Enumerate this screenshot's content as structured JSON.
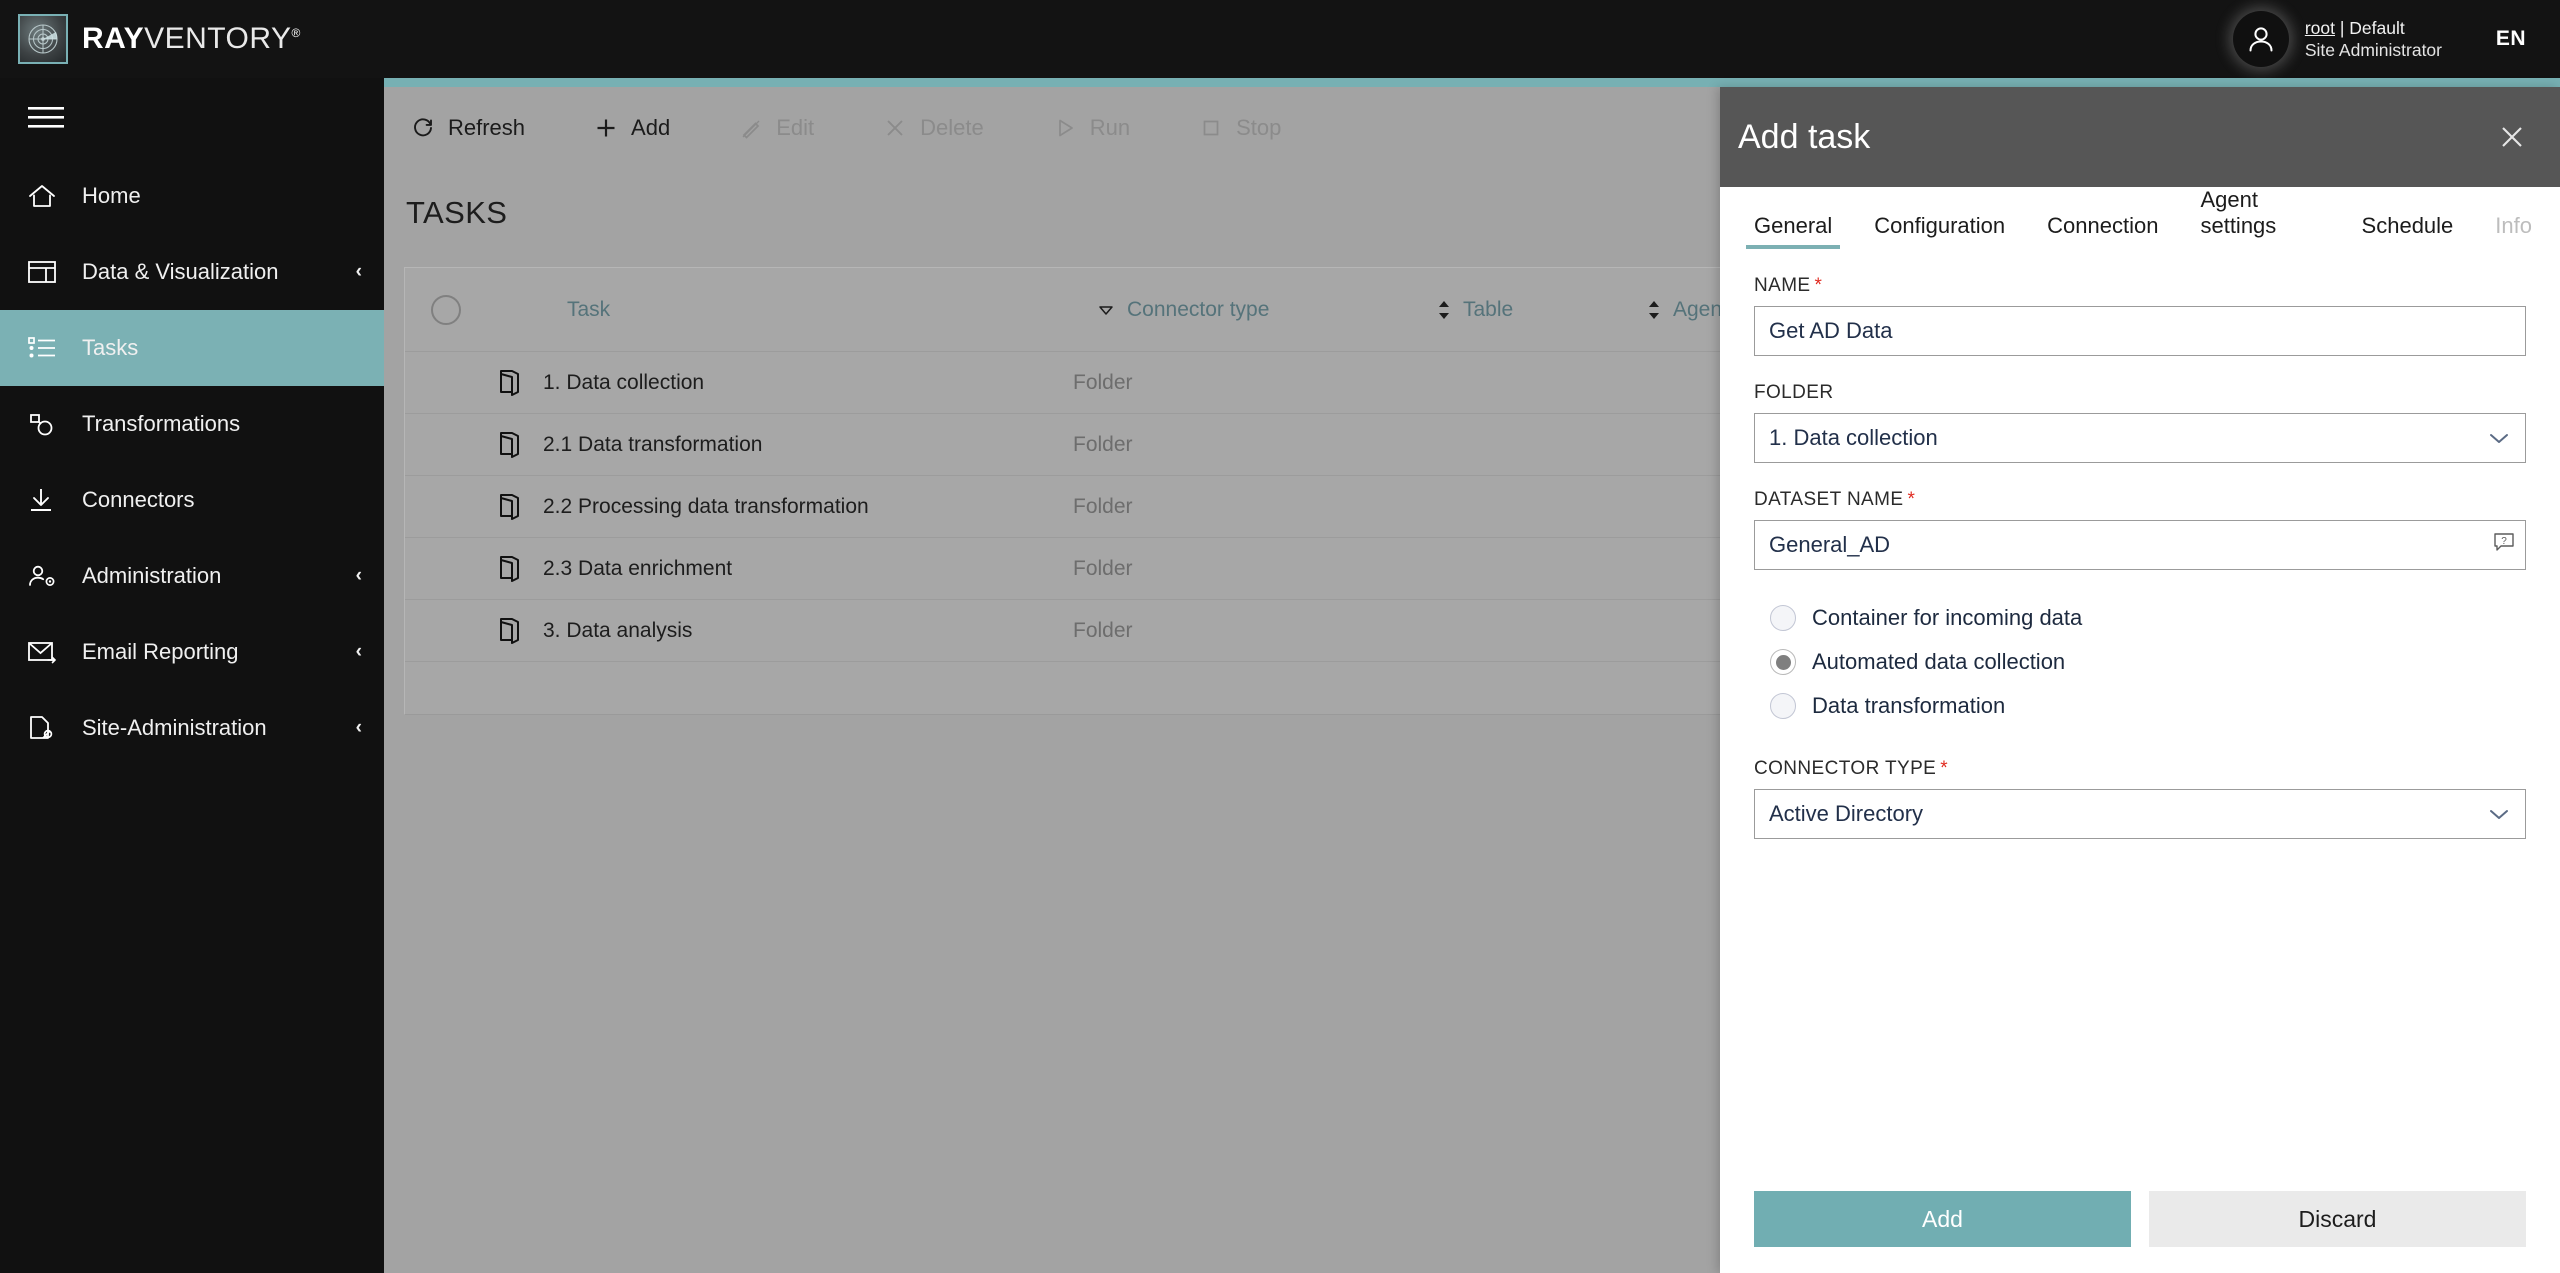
{
  "brand": {
    "name_bold": "RAY",
    "name_light": "VENTORY",
    "registered": "®",
    "logo_icon": "radar-icon"
  },
  "topbar": {
    "user_line1_link": "root",
    "user_line1_rest": " | Default",
    "user_line2": "Site Administrator",
    "language": "EN",
    "avatar_icon": "user-avatar-icon"
  },
  "sidebar": {
    "menu_icon": "hamburger-menu-icon",
    "items": [
      {
        "label": "Home",
        "icon": "home-icon",
        "chevron": "",
        "active": false
      },
      {
        "label": "Data & Visualization",
        "icon": "dashboard-icon",
        "chevron": "‹",
        "active": false
      },
      {
        "label": "Tasks",
        "icon": "task-list-icon",
        "chevron": "",
        "active": true
      },
      {
        "label": "Transformations",
        "icon": "transformations-icon",
        "chevron": "",
        "active": false
      },
      {
        "label": "Connectors",
        "icon": "download-icon",
        "chevron": "",
        "active": false
      },
      {
        "label": "Administration",
        "icon": "user-gear-icon",
        "chevron": "‹",
        "active": false
      },
      {
        "label": "Email Reporting",
        "icon": "envelope-icon",
        "chevron": "‹",
        "active": false
      },
      {
        "label": "Site-Administration",
        "icon": "page-tag-icon",
        "chevron": "‹",
        "active": false
      }
    ]
  },
  "toolbar": {
    "buttons": [
      {
        "label": "Refresh",
        "icon": "refresh-icon",
        "disabled": false
      },
      {
        "label": "Add",
        "icon": "plus-icon",
        "disabled": false
      },
      {
        "label": "Edit",
        "icon": "pencil-icon",
        "disabled": true
      },
      {
        "label": "Delete",
        "icon": "x-icon",
        "disabled": true
      },
      {
        "label": "Run",
        "icon": "play-icon",
        "disabled": true
      },
      {
        "label": "Stop",
        "icon": "stop-icon",
        "disabled": true
      }
    ]
  },
  "main": {
    "page_title": "TASKS",
    "table": {
      "select_all_icon": "select-all-circle-icon",
      "columns": [
        {
          "label": "Task",
          "sort": "desc"
        },
        {
          "label": "Connector type",
          "sort": "none"
        },
        {
          "label": "Table",
          "sort": "none"
        },
        {
          "label": "Agent",
          "sort": "none"
        }
      ],
      "rows": [
        {
          "icon": "folder-icon",
          "task": "1. Data collection",
          "connector_type": "Folder",
          "table": "",
          "agent": ""
        },
        {
          "icon": "folder-icon",
          "task": "2.1 Data transformation",
          "connector_type": "Folder",
          "table": "",
          "agent": ""
        },
        {
          "icon": "folder-icon",
          "task": "2.2 Processing data transformation",
          "connector_type": "Folder",
          "table": "",
          "agent": ""
        },
        {
          "icon": "folder-icon",
          "task": "2.3 Data enrichment",
          "connector_type": "Folder",
          "table": "",
          "agent": ""
        },
        {
          "icon": "folder-icon",
          "task": "3. Data analysis",
          "connector_type": "Folder",
          "table": "",
          "agent": ""
        }
      ]
    }
  },
  "panel": {
    "title": "Add task",
    "close_icon": "close-icon",
    "tabs": [
      {
        "label": "General",
        "active": true,
        "disabled": false
      },
      {
        "label": "Configuration",
        "active": false,
        "disabled": false
      },
      {
        "label": "Connection",
        "active": false,
        "disabled": false
      },
      {
        "label": "Agent settings",
        "active": false,
        "disabled": false
      },
      {
        "label": "Schedule",
        "active": false,
        "disabled": false
      },
      {
        "label": "Info",
        "active": false,
        "disabled": true
      }
    ],
    "fields": {
      "name": {
        "label": "NAME",
        "required": true,
        "value": "Get AD Data",
        "placeholder": ""
      },
      "folder": {
        "label": "FOLDER",
        "required": false,
        "value": "1. Data collection",
        "chevron_icon": "chevron-down-icon"
      },
      "dataset_name": {
        "label": "DATASET NAME",
        "required": true,
        "value": "General_AD",
        "help_icon": "help-tooltip-icon"
      },
      "connector_type": {
        "label": "CONNECTOR TYPE",
        "required": true,
        "value": "Active Directory",
        "chevron_icon": "chevron-down-icon"
      }
    },
    "radio_group": {
      "options": [
        {
          "label": "Container for incoming data",
          "selected": false
        },
        {
          "label": "Automated data collection",
          "selected": true
        },
        {
          "label": "Data transformation",
          "selected": false
        }
      ]
    },
    "actions": {
      "primary": "Add",
      "secondary": "Discard"
    }
  },
  "colors": {
    "accent_teal": "#77b0b3",
    "sidebar_black": "#111111",
    "panel_header_gray": "#565656",
    "content_gray": "#a3a3a3",
    "required_red": "#e02b20",
    "header_link_teal": "#55737a"
  }
}
